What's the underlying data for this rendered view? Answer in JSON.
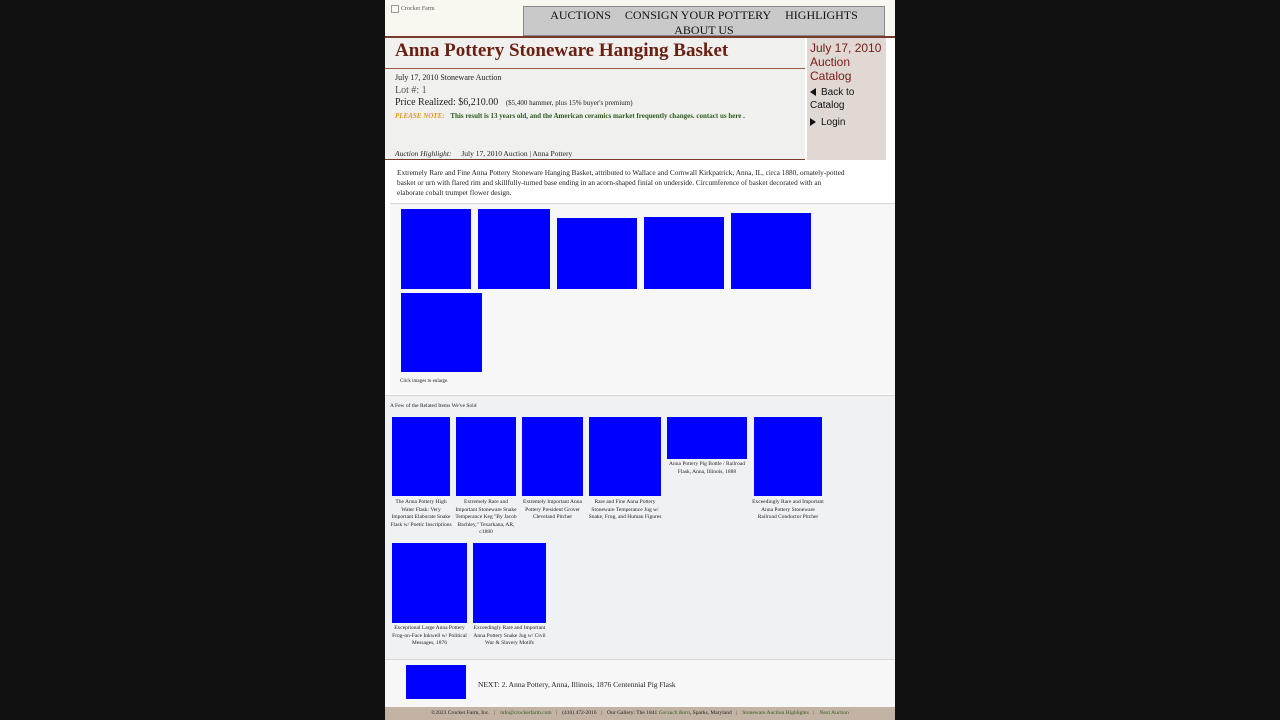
{
  "header": {
    "logo_alt": "Crocker Farm",
    "nav": [
      "AUCTIONS",
      "CONSIGN YOUR POTTERY",
      "HIGHLIGHTS",
      "ABOUT US"
    ]
  },
  "lot": {
    "title": "Anna Pottery Stoneware Hanging Basket",
    "auction": "July 17, 2010 Stoneware Auction",
    "lot_number": "Lot #: 1",
    "price_label": "Price Realized: $6,210.00",
    "price_detail": "($5,400 hammer, plus 15% buyer's premium)",
    "note_label": "PLEASE NOTE:",
    "note_text": "This result is 13 years old, and the American ceramics market frequently changes. contact us here .",
    "highlight_label": "Auction Highlight:",
    "highlight_text": "July 17, 2010 Auction | Anna Pottery"
  },
  "side": {
    "title": "July 17, 2010 Auction Catalog",
    "back": "Back to Catalog",
    "login": "Login"
  },
  "description": "Extremely Rare and Fine Anna Pottery Stoneware Hanging Basket, attributed to Wallace and Cornwall Kirkpatrick, Anna, IL, circa 1880, ornately-potted basket or urn with flared rim and skillfully-turned base ending in an acorn-shaped finial on underside. Circumference of basket decorated with an elaborate cobalt trumpet flower design.",
  "images": {
    "click_note": "Click images to enlarge."
  },
  "related": {
    "title": "A Few of the Related Items We've Sold",
    "items": [
      "The Anna Pottery High Water Flask: Very Important Elaborate Snake Flask w/ Poetic Inscriptions",
      "Extremely Rare and Important Stoneware Snake Temperance Keg \"By Jacob Bachley,\" Texarkana, AR, c1880",
      "Extremely Important Anna Pottery President Grover Cleveland Pitcher",
      "Rare and Fine Anna Pottery Stoneware Temperance Jug w/ Snake, Frog, and Human Figures",
      "Anna Pottery Pig Bottle / Railroad Flask, Anna, Illinois, 1888",
      "Exceedingly Rare and Important Anna Pottery Stoneware Railroad Conductor Pitcher",
      "Exceptional Large Anna Pottery Frog-on-Face Inkwell w/ Political Messages, 1876",
      "Exceedingly Rare and Important Anna Pottery Snake Jug w/ Civil War & Slavery Motifs"
    ]
  },
  "next": {
    "text": "NEXT: 2. Anna Pottery, Anna, Illinois, 1876 Centennial Pig Flask"
  },
  "footer": {
    "copyright": "©2023 Crocker Farm, Inc.",
    "email": "info@crockerfarm.com",
    "phone": "(410) 472-2016",
    "gallery_prefix": "Our Gallery: The 1841",
    "gallery_name": "Gorsuch Barn",
    "gallery_suffix": ", Sparks, Maryland",
    "link1": "Stoneware Auction Highlights",
    "link2": "Next Auction"
  },
  "colors": {
    "image_placeholder": "#0000ff",
    "title": "#6b2012",
    "note_label": "#e09a20",
    "note_text": "#2c5a1a"
  }
}
